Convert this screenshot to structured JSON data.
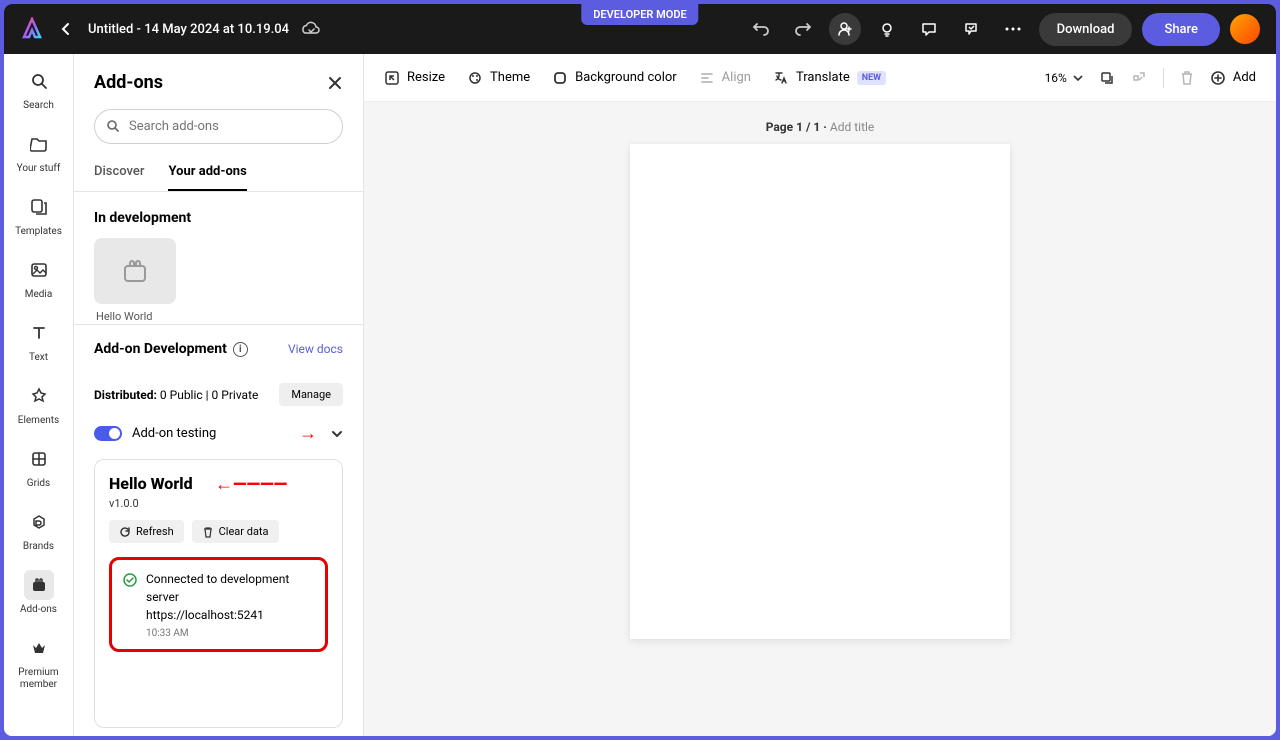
{
  "devmode": "DEVELOPER MODE",
  "doc_title": "Untitled - 14 May 2024 at 10.19.04",
  "download": "Download",
  "share": "Share",
  "rail": {
    "search": "Search",
    "yourstuff": "Your stuff",
    "templates": "Templates",
    "media": "Media",
    "text": "Text",
    "elements": "Elements",
    "grids": "Grids",
    "brands": "Brands",
    "addons": "Add-ons",
    "premium": "Premium member"
  },
  "panel": {
    "title": "Add-ons",
    "search_placeholder": "Search add-ons",
    "tab_discover": "Discover",
    "tab_your": "Your add-ons",
    "indev": "In development",
    "addon_name": "Hello World",
    "dev_title": "Add-on Development",
    "view_docs": "View docs",
    "dist_label": "Distributed:",
    "dist_value": "0 Public | 0 Private",
    "manage": "Manage",
    "testing_label": "Add-on testing",
    "project_name": "Hello World",
    "version": "v1.0.0",
    "refresh": "Refresh",
    "clear": "Clear data",
    "status_msg": "Connected to development server",
    "status_url": "https://localhost:5241",
    "status_time": "10:33 AM"
  },
  "toolbar": {
    "resize": "Resize",
    "theme": "Theme",
    "bgcolor": "Background color",
    "align": "Align",
    "translate": "Translate",
    "new": "NEW",
    "zoom": "16%",
    "add": "Add"
  },
  "canvas": {
    "page_label": "Page 1 / 1 · ",
    "add_title": "Add title"
  }
}
